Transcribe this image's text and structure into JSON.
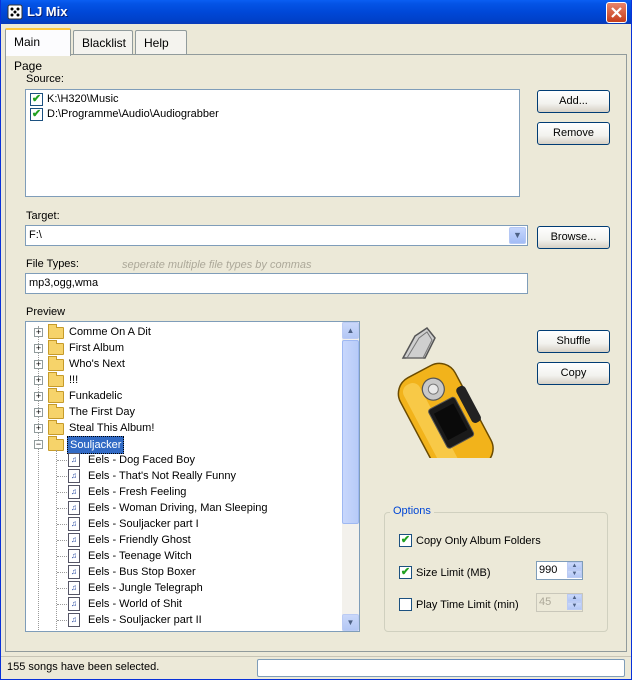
{
  "window": {
    "title": "LJ Mix"
  },
  "tabs": [
    {
      "label": "Main Page",
      "active": true
    },
    {
      "label": "Blacklist",
      "active": false
    },
    {
      "label": "Help",
      "active": false
    }
  ],
  "source": {
    "label": "Source:",
    "items": [
      {
        "path": "K:\\H320\\Music",
        "checked": true
      },
      {
        "path": "D:\\Programme\\Audio\\Audiograbber",
        "checked": true
      }
    ],
    "add_label": "Add...",
    "remove_label": "Remove"
  },
  "target": {
    "label": "Target:",
    "value": "F:\\",
    "browse_label": "Browse..."
  },
  "file_types": {
    "label": "File Types:",
    "hint": "seperate multiple file types by commas",
    "value": "mp3,ogg,wma"
  },
  "preview": {
    "label": "Preview",
    "folders": [
      "Comme On A Dit",
      "First Album",
      "Who's Next",
      "!!!",
      "Funkadelic",
      "The First Day",
      "Steal This Album!"
    ],
    "expanded_folder": "Souljacker",
    "songs": [
      "Eels - Dog Faced Boy",
      "Eels - That's Not Really Funny",
      "Eels - Fresh Feeling",
      "Eels - Woman Driving, Man Sleeping",
      "Eels - Souljacker part I",
      "Eels - Friendly Ghost",
      "Eels - Teenage Witch",
      "Eels - Bus Stop Boxer",
      "Eels - Jungle Telegraph",
      "Eels - World of Shit",
      "Eels - Souljacker part II"
    ]
  },
  "actions": {
    "shuffle_label": "Shuffle",
    "copy_label": "Copy"
  },
  "options": {
    "title": "Options",
    "copy_only_album_folders": {
      "label": "Copy Only Album Folders",
      "checked": true
    },
    "size_limit": {
      "label": "Size Limit (MB)",
      "checked": true,
      "value": "990"
    },
    "play_time_limit": {
      "label": "Play Time Limit (min)",
      "checked": false,
      "value": "45"
    }
  },
  "status": {
    "text": "155 songs have been selected."
  },
  "colors": {
    "titlebar": "#0048d8",
    "selection": "#316ac5",
    "player_body": "#f2b31b"
  }
}
